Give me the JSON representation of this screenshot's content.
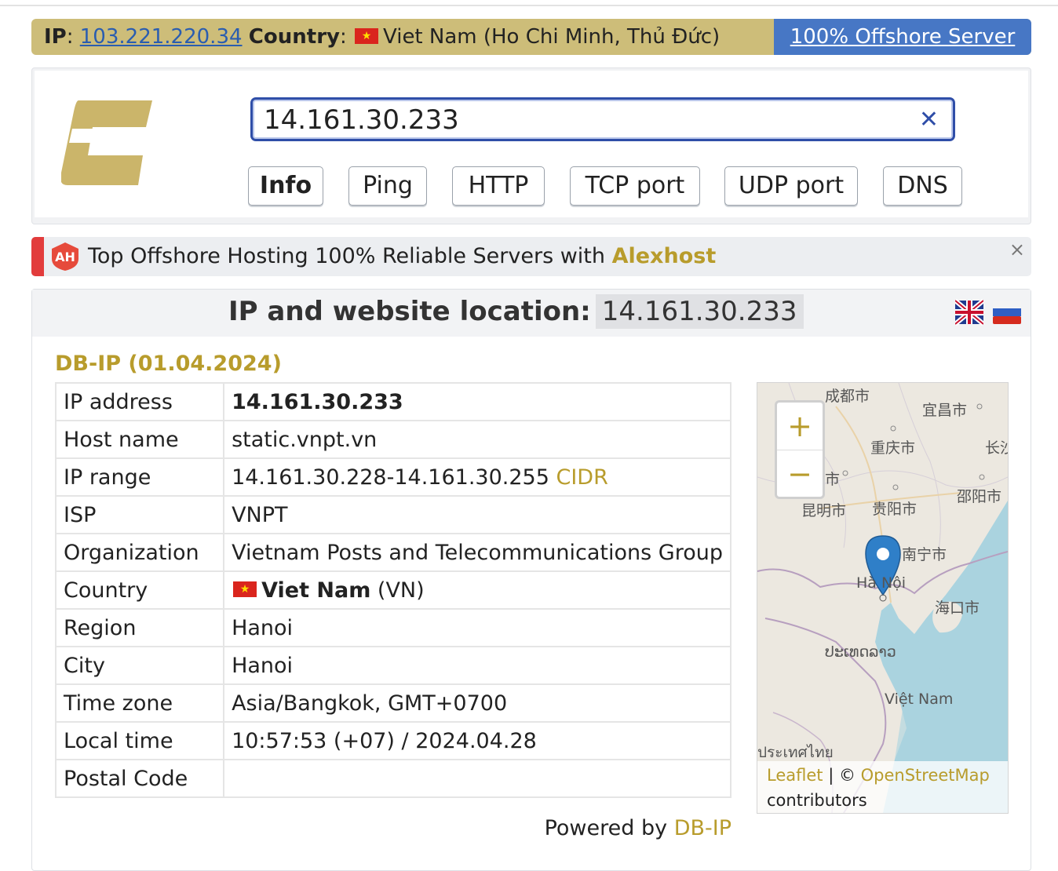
{
  "banner": {
    "ip_label": "IP",
    "ip_value": "103.221.220.34",
    "country_label": "Country",
    "country_value": "Viet Nam (Ho Chi Minh, Thủ Đức)",
    "offshore_link": "100% Offshore Server"
  },
  "search": {
    "value": "14.161.30.233",
    "clear_icon": "close-icon",
    "buttons": [
      "Info",
      "Ping",
      "HTTP",
      "TCP port",
      "UDP port",
      "DNS"
    ],
    "active_button": "Info"
  },
  "ad": {
    "text": "Top Offshore Hosting 100% Reliable Servers with",
    "brand": "Alexhost",
    "close": "×"
  },
  "result": {
    "title": "IP and website location:",
    "ip": "14.161.30.233",
    "languages": [
      "english-flag-icon",
      "russian-flag-icon"
    ],
    "source_title": "DB-IP (01.04.2024)",
    "rows": [
      {
        "key": "IP address",
        "value": "14.161.30.233"
      },
      {
        "key": "Host name",
        "value": "static.vnpt.vn"
      },
      {
        "key": "IP range",
        "value": "14.161.30.228-14.161.30.255",
        "link": "CIDR"
      },
      {
        "key": "ISP",
        "value": "VNPT"
      },
      {
        "key": "Organization",
        "value": "Vietnam Posts and Telecommunications Group"
      },
      {
        "key": "Country",
        "value": "Viet Nam",
        "suffix": "(VN)"
      },
      {
        "key": "Region",
        "value": "Hanoi"
      },
      {
        "key": "City",
        "value": "Hanoi"
      },
      {
        "key": "Time zone",
        "value": "Asia/Bangkok, GMT+0700"
      },
      {
        "key": "Local time",
        "value": "10:57:53 (+07) / 2024.04.28"
      },
      {
        "key": "Postal Code",
        "value": ""
      }
    ],
    "powered_by": "Powered by",
    "powered_link": "DB-IP"
  },
  "map": {
    "zoom_in": "+",
    "zoom_out": "−",
    "labels": [
      "成都市",
      "宜昌市",
      "重庆市",
      "长沙",
      "市",
      "邵阳市",
      "昆明市",
      "贵阳市",
      "南宁市",
      "Hà Nội",
      "海口市",
      "ປະເທດລາວ",
      "Việt Nam",
      "ประเทศไทย"
    ],
    "attribution_leaflet": "Leaflet",
    "attribution_sep": " | © ",
    "attribution_osm": "OpenStreetMap",
    "attribution_contrib": "contributors"
  },
  "colors": {
    "gold": "#b89c2c",
    "banner_bg": "#cdbd79",
    "banner_link_bg": "#4777c5",
    "ad_stripe": "#e23c3c"
  }
}
